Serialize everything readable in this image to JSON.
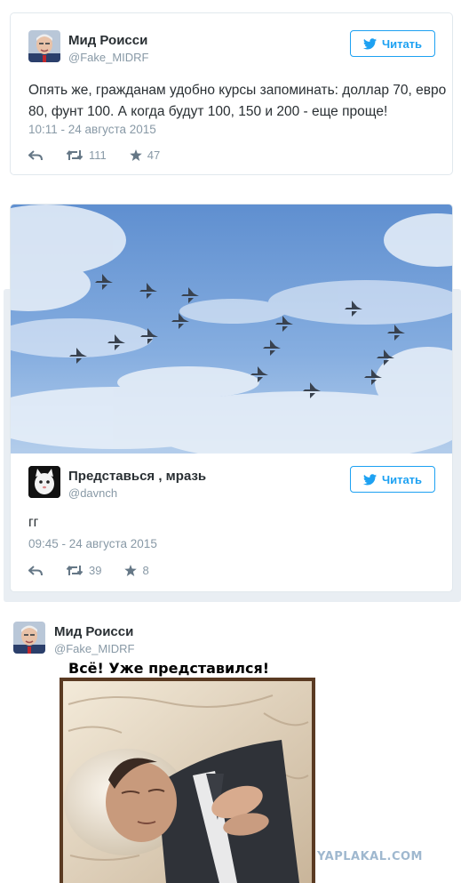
{
  "tweet1": {
    "name": "Мид Роисси",
    "handle": "@Fake_MIDRF",
    "follow_label": "Читать",
    "text": "Опять же, гражданам удобно курсы запоминать: доллар 70, евро 80, фунт 100. А когда будут 100, 150 и 200 - еще проще!",
    "timestamp": "10:11 - 24 августа 2015",
    "retweets": "111",
    "favorites": "47"
  },
  "tweet2": {
    "name": "Представься , мразь",
    "handle": "@davnch",
    "follow_label": "Читать",
    "text": "гг",
    "timestamp": "09:45 - 24 августа 2015",
    "retweets": "39",
    "favorites": "8"
  },
  "tweet3": {
    "name": "Мид Роисси",
    "handle": "@Fake_MIDRF",
    "caption": "Всё! Уже представился!"
  },
  "watermark": "YAPLAKAL.COM",
  "icons": {
    "reply": "reply-icon",
    "retweet": "retweet-icon",
    "favorite": "star-icon",
    "follow": "twitter-bird-icon"
  },
  "colors": {
    "accent": "#1da1f2",
    "muted": "#8899a6",
    "text": "#292f33",
    "sky": "#8fb6e0"
  }
}
